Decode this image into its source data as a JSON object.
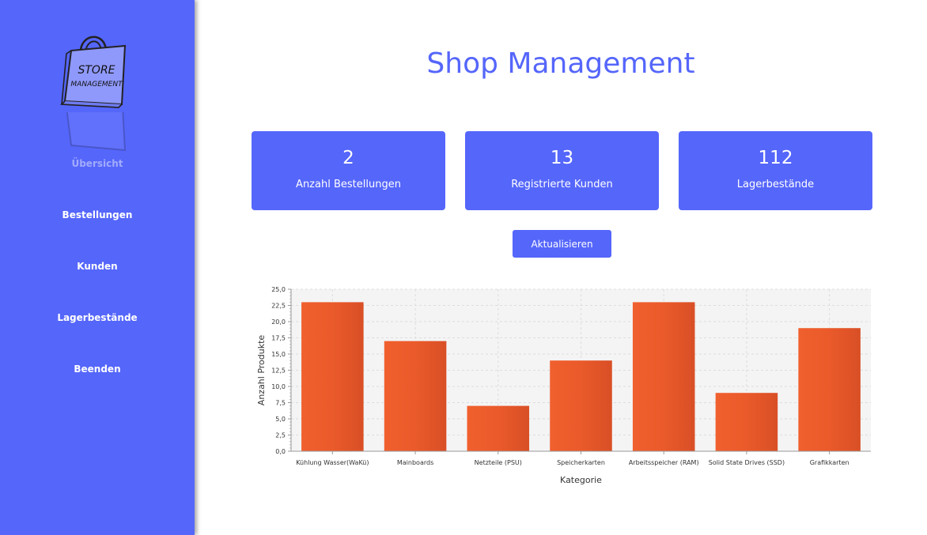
{
  "sidebar": {
    "logo": {
      "line1": "STORE",
      "line2": "MANAGEMENT"
    },
    "items": [
      {
        "label": "Übersicht",
        "active": true
      },
      {
        "label": "Bestellungen",
        "active": false
      },
      {
        "label": "Kunden",
        "active": false
      },
      {
        "label": "Lagerbestände",
        "active": false
      },
      {
        "label": "Beenden",
        "active": false
      }
    ]
  },
  "main": {
    "title": "Shop Management",
    "cards": [
      {
        "value": "2",
        "label": "Anzahl Bestellungen"
      },
      {
        "value": "13",
        "label": "Registrierte Kunden"
      },
      {
        "value": "112",
        "label": "Lagerbestände"
      }
    ],
    "refresh_label": "Aktualisieren"
  },
  "colors": {
    "accent": "#5566fb",
    "bar": "#ee5b2c",
    "plot_bg": "#f4f4f4"
  },
  "chart_data": {
    "type": "bar",
    "categories": [
      "Kühlung Wasser(WaKü)",
      "Mainboards",
      "Netzteile (PSU)",
      "Speicherkarten",
      "Arbeitsspeicher (RAM)",
      "Solid State Drives (SSD)",
      "Grafikkarten"
    ],
    "values": [
      23,
      17,
      7,
      14,
      23,
      9,
      19
    ],
    "xlabel": "Kategorie",
    "ylabel": "Anzahl Produkte",
    "ylim": [
      0,
      25
    ],
    "yticks": [
      "0,0",
      "2,5",
      "5,0",
      "7,5",
      "10,0",
      "12,5",
      "15,0",
      "17,5",
      "20,0",
      "22,5",
      "25,0"
    ],
    "grid": true,
    "legend": "none"
  }
}
